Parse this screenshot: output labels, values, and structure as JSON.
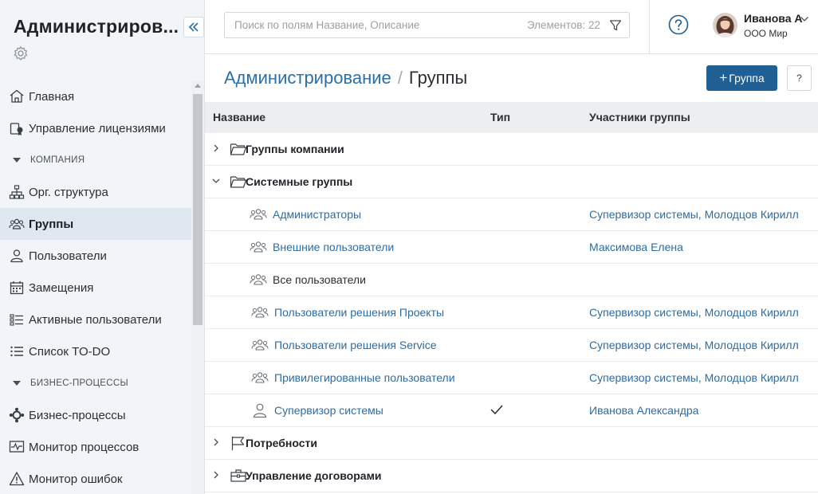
{
  "sidebar": {
    "app_title": "Администриров...",
    "items": [
      {
        "label": "Главная",
        "icon": "home-icon"
      },
      {
        "label": "Управление лицензиями",
        "icon": "license-icon"
      },
      {
        "section": "КОМПАНИЯ"
      },
      {
        "label": "Орг. структура",
        "icon": "org-structure-icon"
      },
      {
        "label": "Группы",
        "icon": "groups-icon",
        "active": true
      },
      {
        "label": "Пользователи",
        "icon": "user-icon"
      },
      {
        "label": "Замещения",
        "icon": "calendar-icon"
      },
      {
        "label": "Активные пользователи",
        "icon": "active-users-icon"
      },
      {
        "label": "Список TO-DO",
        "icon": "todo-list-icon"
      },
      {
        "section": "БИЗНЕС-ПРОЦЕССЫ"
      },
      {
        "label": "Бизнес-процессы",
        "icon": "business-process-icon"
      },
      {
        "label": "Монитор процессов",
        "icon": "process-monitor-icon"
      },
      {
        "label": "Монитор ошибок",
        "icon": "error-monitor-icon"
      }
    ]
  },
  "header": {
    "search_placeholder": "Поиск по полям Название, Описание",
    "search_value": "",
    "count_label": "Элементов: 22",
    "user_name": "Иванова А",
    "user_org": "ООО Мир"
  },
  "page": {
    "breadcrumb_root": "Администрирование",
    "breadcrumb_separator": "/",
    "breadcrumb_current": "Группы",
    "add_button": "Группа",
    "help_button": "?"
  },
  "table": {
    "columns": [
      "Название",
      "Тип",
      "Участники группы"
    ],
    "rows": [
      {
        "kind": "folder",
        "expanded": false,
        "icon": "folder-open-icon",
        "name": "Группы компании",
        "members": ""
      },
      {
        "kind": "folder",
        "expanded": true,
        "icon": "folder-open-icon",
        "name": "Системные группы",
        "members": ""
      },
      {
        "kind": "group",
        "icon": "group-icon",
        "name": "Администраторы",
        "link": true,
        "members": "Супервизор системы, Молодцов Кирилл"
      },
      {
        "kind": "group",
        "icon": "group-icon",
        "name": "Внешние пользователи",
        "link": true,
        "members": "Максимова Елена"
      },
      {
        "kind": "group",
        "icon": "group-icon",
        "name": "Все пользователи",
        "link": false,
        "members": ""
      },
      {
        "kind": "group",
        "icon": "group-icon",
        "name": "Пользователи решения Проекты",
        "link": true,
        "members": "Супервизор системы, Молодцов Кирилл"
      },
      {
        "kind": "group",
        "icon": "group-icon",
        "name": "Пользователи решения Service",
        "link": true,
        "members": "Супервизор системы, Молодцов Кирилл"
      },
      {
        "kind": "group",
        "icon": "group-icon",
        "name": "Привилегированные пользователи",
        "link": true,
        "members": "Супервизор системы, Молодцов Кирилл"
      },
      {
        "kind": "group",
        "icon": "person-icon",
        "name": "Супервизор системы",
        "link": true,
        "type_check": true,
        "members": "Иванова Александра"
      },
      {
        "kind": "folder",
        "expanded": false,
        "icon": "flag-icon",
        "name": "Потребности",
        "members": ""
      },
      {
        "kind": "folder",
        "expanded": false,
        "icon": "briefcase-icon",
        "name": "Управление договорами",
        "members": ""
      }
    ]
  },
  "colors": {
    "accent": "#1f5f94",
    "link": "#2d6ca3",
    "sidebar_bg": "#f1f5f9",
    "active_bg": "#dfe8f1"
  }
}
